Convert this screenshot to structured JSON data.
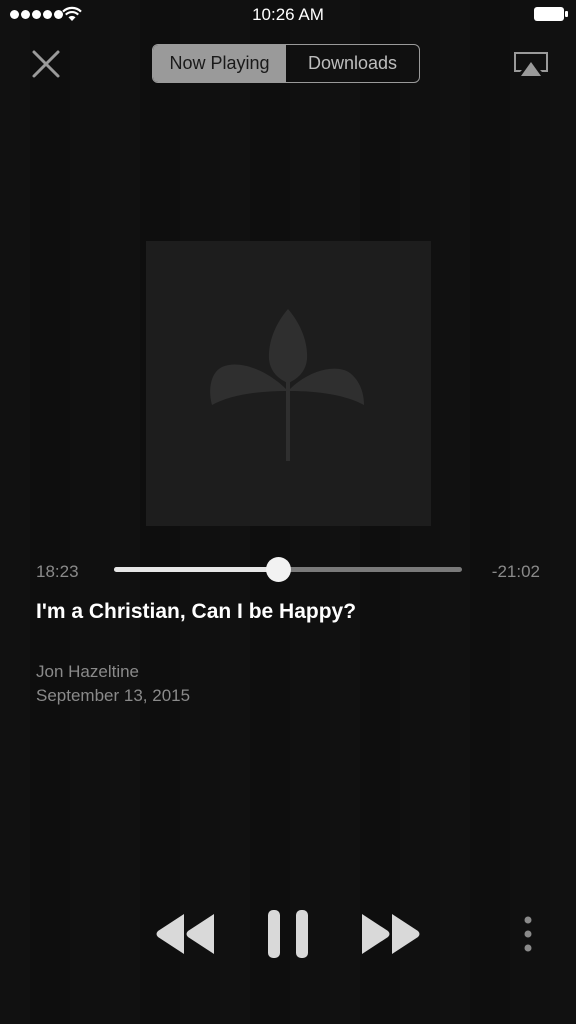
{
  "status_bar": {
    "time": "10:26 AM",
    "signal_icon": "signal-dots-icon",
    "wifi_icon": "wifi-icon",
    "battery_icon": "battery-icon"
  },
  "nav": {
    "close_icon": "close-icon",
    "tabs": [
      {
        "label": "Now Playing",
        "active": true
      },
      {
        "label": "Downloads",
        "active": false
      }
    ],
    "airplay_icon": "airplay-icon"
  },
  "artwork": {
    "icon": "leaf-logo-icon"
  },
  "player": {
    "elapsed": "18:23",
    "remaining": "-21:02",
    "progress_fraction": 0.47
  },
  "track": {
    "title": "I'm a Christian, Can I be Happy?",
    "author": "Jon Hazeltine",
    "date": "September 13, 2015"
  },
  "controls": {
    "rewind_icon": "rewind-icon",
    "pause_icon": "pause-icon",
    "forward_icon": "fast-forward-icon",
    "more_icon": "more-vertical-icon"
  },
  "colors": {
    "background": "#0e0e0e",
    "segment_active": "#9a9a9a",
    "track_fill": "#e6e6e6",
    "track_rest": "#7a7a7a",
    "secondary_text": "#8a8a8a"
  }
}
